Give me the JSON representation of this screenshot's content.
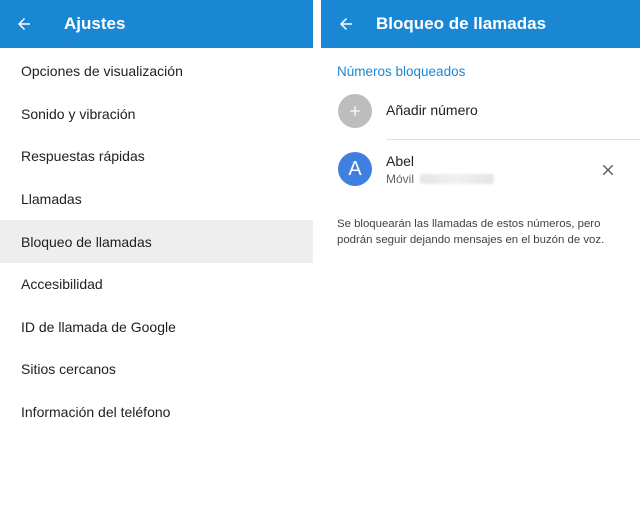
{
  "settings": {
    "title": "Ajustes",
    "items": [
      {
        "label": "Opciones de visualización"
      },
      {
        "label": "Sonido y vibración"
      },
      {
        "label": "Respuestas rápidas"
      },
      {
        "label": "Llamadas"
      },
      {
        "label": "Bloqueo de llamadas",
        "active": true
      },
      {
        "label": "Accesibilidad"
      },
      {
        "label": "ID de llamada de Google"
      },
      {
        "label": "Sitios cercanos"
      },
      {
        "label": "Información del teléfono"
      }
    ]
  },
  "blocking": {
    "title": "Bloqueo de llamadas",
    "section_header": "Números bloqueados",
    "add_label": "Añadir número",
    "contact": {
      "initial": "A",
      "name": "Abel",
      "type": "Móvil"
    },
    "note": "Se bloquearán las llamadas de estos números, pero podrán seguir dejando mensajes en el buzón de voz."
  },
  "colors": {
    "appbar": "#1a87d4",
    "accent": "#1a87d4",
    "avatar": "#3f7fe0",
    "add_circle": "#bdbdbd",
    "active_row": "#eeeeee"
  },
  "icons": {
    "back": "arrow-back-icon",
    "add": "plus-icon",
    "remove": "close-icon"
  }
}
